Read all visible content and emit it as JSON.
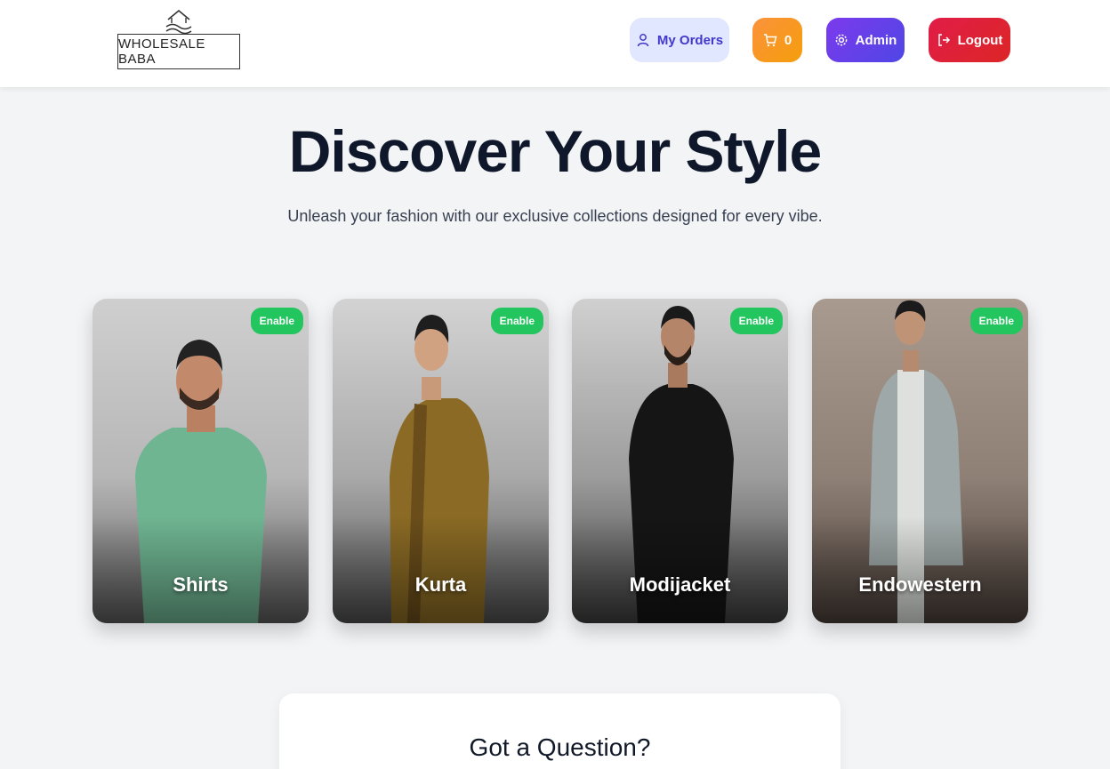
{
  "brand": {
    "name": "WHOLESALE BABA"
  },
  "nav": {
    "orders_label": "My Orders",
    "cart_count": "0",
    "admin_label": "Admin",
    "logout_label": "Logout"
  },
  "hero": {
    "title": "Discover Your Style",
    "subtitle": "Unleash your fashion with our exclusive collections designed for every vibe."
  },
  "categories": [
    {
      "label": "Shirts",
      "badge": "Enable"
    },
    {
      "label": "Kurta",
      "badge": "Enable"
    },
    {
      "label": "Modijacket",
      "badge": "Enable"
    },
    {
      "label": "Endowestern",
      "badge": "Enable"
    }
  ],
  "question": {
    "title": "Got a Question?"
  },
  "colors": {
    "badge": "#22c55e",
    "orders_bg": "#e0e7ff",
    "cart": "#f59e0b",
    "admin": "#7c3aed",
    "logout": "#e11d48"
  }
}
